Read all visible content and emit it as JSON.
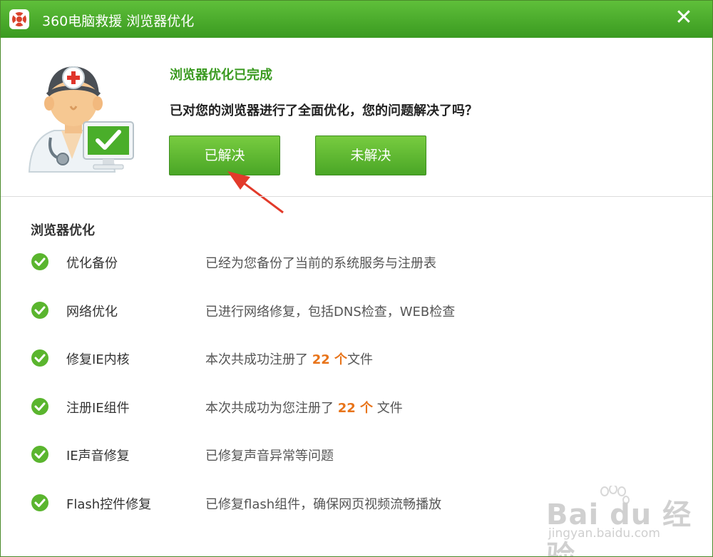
{
  "window": {
    "title": "360电脑救援  浏览器优化",
    "close_glyph": "✕",
    "app_icon": "lifebuoy-icon"
  },
  "header": {
    "status_title": "浏览器优化已完成",
    "question": "已对您的浏览器进行了全面优化，您的问题解决了吗？",
    "solved_label": "已解决",
    "unsolved_label": "未解决"
  },
  "section": {
    "title": "浏览器优化",
    "items": [
      {
        "name": "优化备份",
        "desc": "已经为您备份了当前的系统服务与注册表"
      },
      {
        "name": "网络优化",
        "desc": "已进行网络修复，包括DNS检查，WEB检查"
      },
      {
        "name": "修复IE内核",
        "desc_pre": "本次共成功注册了 ",
        "count": "22 个",
        "desc_post": "文件"
      },
      {
        "name": "注册IE组件",
        "desc_pre": "本次共成功为您注册了 ",
        "count": "22 个",
        "desc_post": " 文件"
      },
      {
        "name": "IE声音修复",
        "desc": "已修复声音异常等问题"
      },
      {
        "name": "Flash控件修复",
        "desc": "已修复flash组件，确保网页视频流畅播放"
      }
    ]
  },
  "watermark": {
    "logo_text": "Bai du 经验",
    "url": "jingyan.baidu.com"
  },
  "colors": {
    "accent_green": "#3a9a20",
    "count_orange": "#e8741a",
    "check_green": "#5ab52e"
  }
}
